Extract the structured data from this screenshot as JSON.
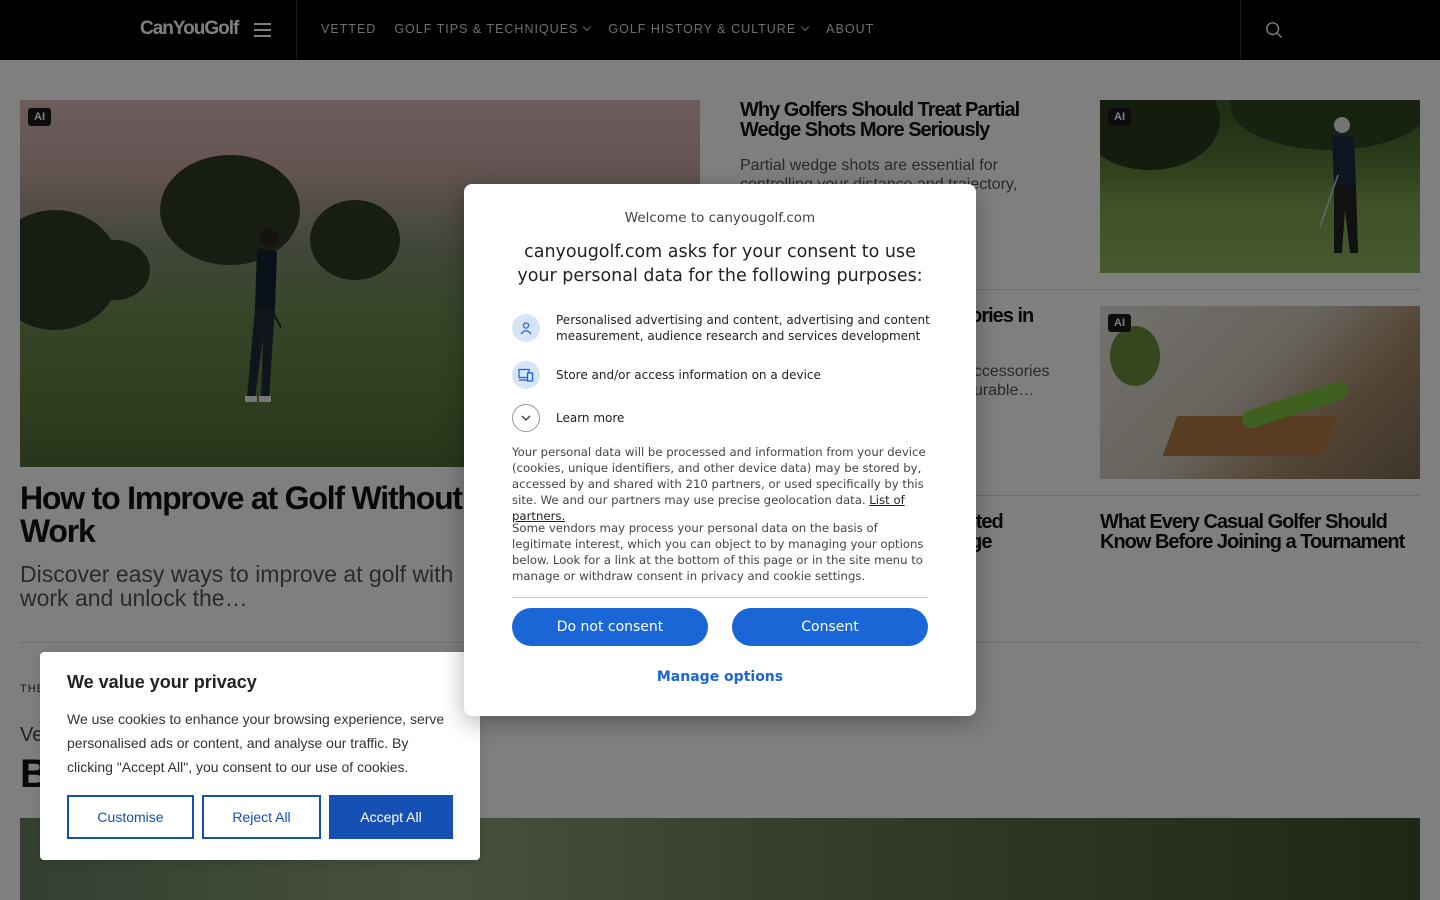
{
  "header": {
    "logo": "CanYouGolf",
    "nav": [
      {
        "label": "VETTED",
        "dropdown": false
      },
      {
        "label": "GOLF TIPS & TECHNIQUES",
        "dropdown": true
      },
      {
        "label": "GOLF HISTORY & CULTURE",
        "dropdown": true
      },
      {
        "label": "ABOUT",
        "dropdown": false
      }
    ]
  },
  "hero": {
    "badge": "AI",
    "title": "How to Improve at Golf Without Ma",
    "title_line2": "Work",
    "subtitle_line1": "Discover easy ways to improve at golf with",
    "subtitle_line2": "work and unlock the…"
  },
  "cards": [
    {
      "title": "Why Golfers Should Treat Partial Wedge Shots More Seriously",
      "subtitle": "Partial wedge shots are essential for controlling your distance and trajectory,",
      "badge": "AI"
    },
    {
      "title_fragment": "sories in",
      "subtitle_fragment_1": "accessories",
      "subtitle_fragment_2": "durable…",
      "badge": "AI"
    },
    {
      "title_fragment_1": "nited",
      "title_fragment_2": "age"
    },
    {
      "title": "What Every Casual Golfer Should Know Before Joining a Tournament"
    }
  ],
  "section": {
    "label_fragment": "THE",
    "vertical_fragment": "Ve",
    "big_fragment": "B"
  },
  "consent_modal": {
    "welcome": "Welcome to canyougolf.com",
    "heading": "canyougolf.com asks for your consent to use your personal data for the following purposes:",
    "purposes": [
      "Personalised advertising and content, advertising and content measurement, audience research and services development",
      "Store and/or access information on a device"
    ],
    "learn_more": "Learn more",
    "paragraph1": "Your personal data will be processed and information from your device (cookies, unique identifiers, and other device data) may be stored by, accessed by and shared with 210 partners, or used specifically by this site. We and our partners may use precise geolocation data.",
    "partners_link": "List of partners.",
    "paragraph2": "Some vendors may process your personal data on the basis of legitimate interest, which you can object to by managing your options below. Look for a link at the bottom of this page or in the site menu to manage or withdraw consent in privacy and cookie settings.",
    "do_not_consent": "Do not consent",
    "consent": "Consent",
    "manage_options": "Manage options",
    "accent_color": "#1a66d6"
  },
  "cookie_banner": {
    "title": "We value your privacy",
    "text": "We use cookies to enhance your browsing experience, serve personalised ads or content, and analyse our traffic. By clicking \"Accept All\", you consent to our use of cookies.",
    "customise": "Customise",
    "reject_all": "Reject All",
    "accept_all": "Accept All",
    "accent_color": "#1550b5"
  }
}
